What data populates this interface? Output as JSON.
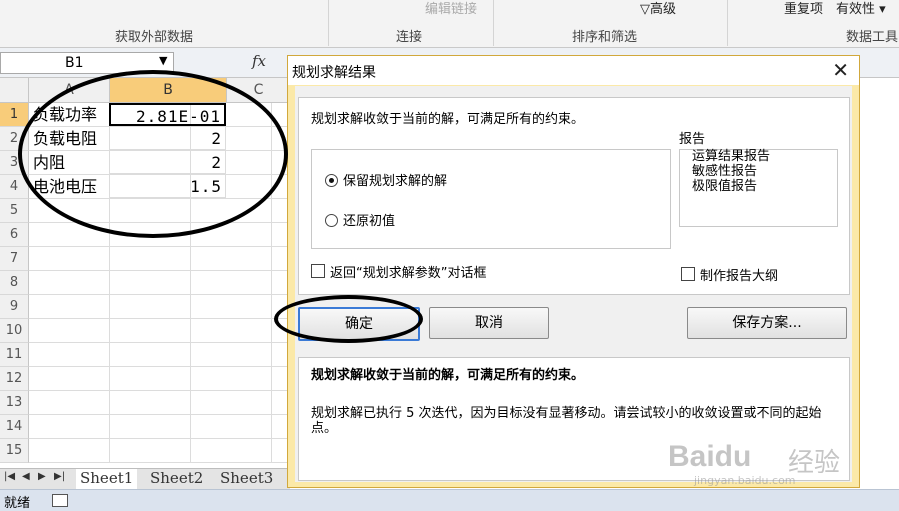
{
  "ribbon": {
    "groups": [
      "获取外部数据",
      "连接",
      "排序和筛选",
      "数据工具"
    ],
    "items": [
      "编辑链接",
      "高级",
      "重复项",
      "有效性"
    ]
  },
  "formula_bar": {
    "name_box": "B1",
    "fx": "fx"
  },
  "grid": {
    "columns": [
      "A",
      "B",
      "C"
    ],
    "rows": [
      "1",
      "2",
      "3",
      "4",
      "5",
      "6",
      "7",
      "8",
      "9",
      "10",
      "11",
      "12",
      "13",
      "14",
      "15"
    ],
    "cells": [
      {
        "label": "负载功率",
        "value": "2.81E-01"
      },
      {
        "label": "负载电阻",
        "value": "2"
      },
      {
        "label": "内阻",
        "value": "2"
      },
      {
        "label": "电池电压",
        "value": "1.5"
      }
    ]
  },
  "sheet_tabs": [
    "Sheet1",
    "Sheet2",
    "Sheet3"
  ],
  "status_bar": {
    "text": "就绪"
  },
  "dialog": {
    "title": "规划求解结果",
    "close": "✕",
    "message": "规划求解收敛于当前的解，可满足所有的约束。",
    "options": {
      "keep": "保留规划求解的解",
      "restore": "还原初值",
      "selected": "keep"
    },
    "reports_label": "报告",
    "reports": [
      "运算结果报告",
      "敏感性报告",
      "极限值报告"
    ],
    "return_checkbox": "返回“规划求解参数”对话框",
    "outline_checkbox": "制作报告大纲",
    "buttons": {
      "ok": "确定",
      "cancel": "取消",
      "save": "保存方案..."
    },
    "detail_title": "规划求解收敛于当前的解，可满足所有的约束。",
    "detail_text": "规划求解已执行 5 次迭代，因为目标没有显著移动。请尝试较小的收敛设置或不同的起始点。"
  },
  "watermark": {
    "logo": "Baidu",
    "cn": "经验",
    "sub": "jingyan.baidu.com"
  }
}
